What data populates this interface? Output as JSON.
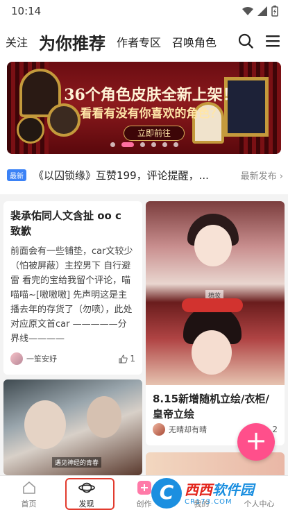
{
  "status_bar": {
    "time": "10:14"
  },
  "top_nav": {
    "tabs": [
      {
        "label": "关注"
      },
      {
        "label": "为你推荐"
      },
      {
        "label": "作者专区"
      },
      {
        "label": "召唤角色"
      }
    ]
  },
  "banner": {
    "title": "36个角色皮肤全新上架！",
    "subtitle": "看看有没有你喜欢的角色？",
    "button": "立即前往",
    "active_slide": 2,
    "slide_count": 6
  },
  "news": {
    "badge": "最新",
    "text": "《以囚锁缘》互赞199，评论提醒，...",
    "more": "最新发布"
  },
  "cards": [
    {
      "title": "裴承佑同人文含扯  oo c 致歉",
      "body": "前面会有一些铺垫，car文较少（怕被屏蔽）主控男下  自行避雷   看完的宝给我留个评论，喵喵喵~[嗷嗷嗷]  先声明这是主播去年的存货了（勿喷），此处对应原文首car  —————分界线————",
      "author": "一笙安妤",
      "likes": "1"
    },
    {
      "title": "8.15新增随机立绘/衣柜/皇帝立绘",
      "author": "无晴却有晴",
      "likes": "2",
      "image_label": "梳妆"
    },
    {
      "image_label": "遇见神经的青春"
    }
  ],
  "fab": {
    "label": "+"
  },
  "tabbar": {
    "tabs": [
      {
        "label": "首页"
      },
      {
        "label": "发现"
      },
      {
        "label": "创作"
      },
      {
        "label": "我的"
      },
      {
        "label": "个人中心"
      }
    ],
    "active": 1
  },
  "watermark": {
    "logo": "C",
    "main_a": "西西",
    "main_b": "软件园",
    "url": "CR173.COM"
  },
  "colors": {
    "accent": "#ff4f8b",
    "highlight": "#e23b2e",
    "badge": "#3b82f6"
  }
}
